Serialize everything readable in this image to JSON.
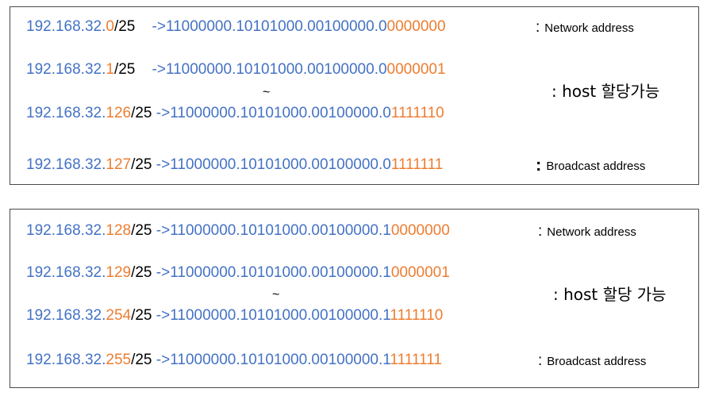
{
  "colors": {
    "blue": "#4472c4",
    "orange": "#ed7d31",
    "border": "#4a4a4a"
  },
  "blocks": [
    {
      "rows": [
        {
          "ip_prefix": "192.168.32.",
          "ip_host": "0",
          "cidr": "/25",
          "gap": "    ",
          "arrow": "->",
          "bin_prefix": "11000000.10101000.00100000.0",
          "bin_host": "0000000",
          "note_colon": ":",
          "note": "Network address"
        },
        {
          "ip_prefix": "192.168.32.",
          "ip_host": "1",
          "cidr": "/25",
          "gap": "    ",
          "arrow": "->",
          "bin_prefix": "11000000.10101000.00100000.0",
          "bin_host": "0000001",
          "note_colon": "",
          "note": ""
        },
        {
          "ip_prefix": "192.168.32.",
          "ip_host": "126",
          "cidr": "/25",
          "gap": " ",
          "arrow": "->",
          "bin_prefix": "11000000.10101000.00100000.0",
          "bin_host": "1111110",
          "note_colon": "",
          "note": ""
        },
        {
          "ip_prefix": "192.168.32.",
          "ip_host": "127",
          "cidr": "/25",
          "gap": " ",
          "arrow": "->",
          "bin_prefix": "11000000.10101000.00100000.0",
          "bin_host": "1111111",
          "note_colon": ":",
          "note": "Broadcast address"
        }
      ],
      "tilde": "~",
      "host_note": ": host 할당가능"
    },
    {
      "rows": [
        {
          "ip_prefix": "192.168.32.",
          "ip_host": "128",
          "cidr": "/25",
          "gap": " ",
          "arrow": "->",
          "bin_prefix": "11000000.10101000.00100000.1",
          "bin_host": "0000000",
          "note_colon": ":",
          "note": "Network address"
        },
        {
          "ip_prefix": "192.168.32.",
          "ip_host": "129",
          "cidr": "/25",
          "gap": " ",
          "arrow": "->",
          "bin_prefix": "11000000.10101000.00100000.1",
          "bin_host": "0000001",
          "note_colon": "",
          "note": ""
        },
        {
          "ip_prefix": "192.168.32.",
          "ip_host": "254",
          "cidr": "/25",
          "gap": " ",
          "arrow": "->",
          "bin_prefix": "11000000.10101000.00100000.1",
          "bin_host": "1111110",
          "note_colon": "",
          "note": ""
        },
        {
          "ip_prefix": "192.168.32.",
          "ip_host": "255",
          "cidr": "/25",
          "gap": " ",
          "arrow": "->",
          "bin_prefix": "11000000.10101000.00100000.1",
          "bin_host": "1111111",
          "note_colon": ":",
          "note": "Broadcast address"
        }
      ],
      "tilde": "~",
      "host_note": ": host 할당 가능"
    }
  ]
}
